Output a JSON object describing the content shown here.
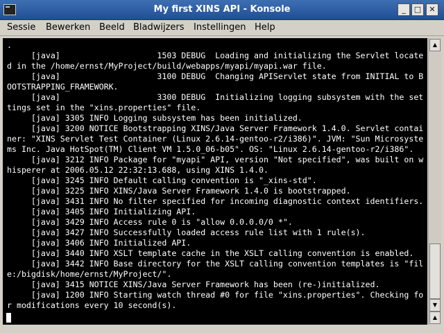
{
  "window": {
    "title": "My first XINS API - Konsole",
    "icon": "terminal-icon",
    "controls": {
      "minimize": "_",
      "maximize": "□",
      "close": "✕"
    }
  },
  "menu": {
    "items": [
      "Sessie",
      "Bewerken",
      "Beeld",
      "Bladwijzers",
      "Instellingen",
      "Help"
    ]
  },
  "terminal": {
    "lines": [
      ".",
      "     [java]                    1503 DEBUG  Loading and initializing the Servlet locate",
      "d in the /home/ernst/MyProject/build/webapps/myapi/myapi.war file.",
      "     [java]                    3100 DEBUG  Changing APIServlet state from INITIAL to B",
      "OOTSTRAPPING_FRAMEWORK.",
      "     [java]                    3300 DEBUG  Initializing logging subsystem with the set",
      "tings set in the \"xins.properties\" file.",
      "     [java] 3305 INFO Logging subsystem has been initialized.",
      "     [java] 3200 NOTICE Bootstrapping XINS/Java Server Framework 1.4.0. Servlet contai",
      "ner: \"XINS Servlet Test Container (Linux 2.6.14-gentoo-r2/i386)\". JVM: \"Sun Microsyste",
      "ms Inc. Java HotSpot(TM) Client VM 1.5.0_06-b05\". OS: \"Linux 2.6.14-gentoo-r2/i386\".",
      "     [java] 3212 INFO Package for \"myapi\" API, version \"Not specified\", was built on w",
      "hisperer at 2006.05.12 22:32:13.688, using XINS 1.4.0.",
      "     [java] 3245 INFO Default calling convention is \"_xins-std\".",
      "     [java] 3225 INFO XINS/Java Server Framework 1.4.0 is bootstrapped.",
      "     [java] 3431 INFO No filter specified for incoming diagnostic context identifiers.",
      "     [java] 3405 INFO Initializing API.",
      "     [java] 3429 INFO Access rule 0 is \"allow 0.0.0.0/0 *\".",
      "     [java] 3427 INFO Successfully loaded access rule list with 1 rule(s).",
      "     [java] 3406 INFO Initialized API.",
      "     [java] 3440 INFO XSLT template cache in the XSLT calling convention is enabled.",
      "     [java] 3442 INFO Base directory for the XSLT calling convention templates is \"fil",
      "e:/bigdisk/home/ernst/MyProject/\".",
      "     [java] 3415 NOTICE XINS/Java Server Framework has been (re-)initialized.",
      "     [java] 1200 INFO Starting watch thread #0 for file \"xins.properties\". Checking fo",
      "r modifications every 10 second(s)."
    ]
  },
  "scrollbar": {
    "up_icon": "▲",
    "down_icon": "▼"
  }
}
